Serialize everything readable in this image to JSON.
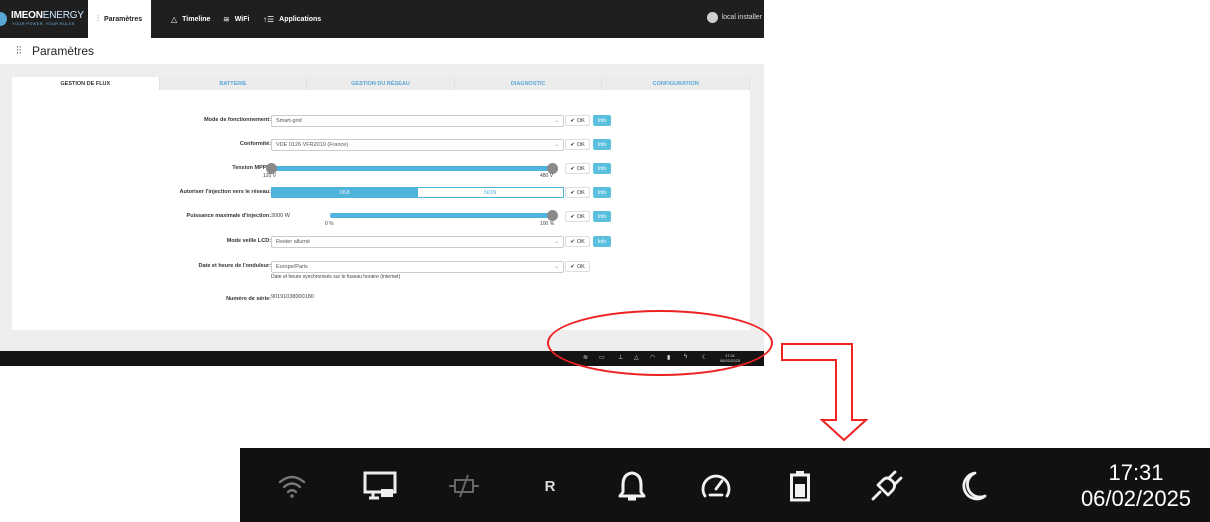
{
  "app": {
    "logo_name": "IMEON",
    "logo_name2": "ENERGY",
    "logo_tagline": "YOUR POWER, YOUR RULES",
    "brand_color": "#5aa7d6",
    "accent_color": "#4fb3dc"
  },
  "nav": {
    "items": [
      {
        "label": "Paramètres",
        "icon": "sliders-icon"
      },
      {
        "label": "Timeline",
        "icon": "bell-icon"
      },
      {
        "label": "WiFi",
        "icon": "wifi-icon"
      },
      {
        "label": "Applications",
        "icon": "apps-icon"
      }
    ],
    "user": "local installer"
  },
  "page": {
    "title": "Paramètres"
  },
  "tabs": [
    "GESTION DE FLUX",
    "BATTERIE",
    "GESTION DU RÉSEAU",
    "DIAGNOSTIC",
    "CONFIGURATION"
  ],
  "form": {
    "mode": {
      "label": "Mode de fonctionnement:",
      "value": "Smart-grid"
    },
    "conformite": {
      "label": "Conformité:",
      "value": "VDE 0126 VFR2019 (France)"
    },
    "mppt": {
      "label": "Tension MPPT:",
      "min": "120 V",
      "max": "480 V"
    },
    "injection": {
      "label": "Autoriser l'injection vers le réseau:",
      "on": "OUI",
      "off": "NON"
    },
    "puissance": {
      "label": "Puissance maximale d'injection:",
      "value": "3000 W",
      "min": "0 %",
      "max": "100 %",
      "level": 1.0
    },
    "lcd": {
      "label": "Mode veille LCD:",
      "value": "Rester allumé"
    },
    "date": {
      "label": "Date et heure de l'onduleur:",
      "value": "Europe/Paris",
      "note": "Date et heure synchronisés sur le fuseau horaire (internet)"
    },
    "serie": {
      "label": "Numéro de série:",
      "value": "90191038000180"
    },
    "ok_label": "OK",
    "info_label": "Info"
  },
  "taskbar": {
    "icons": [
      "wifi-icon",
      "monitor-icon",
      "relay-icon",
      "r-icon",
      "bell-icon",
      "gauge-icon",
      "battery-icon",
      "plug-icon",
      "moon-icon"
    ],
    "r_glyph": "R",
    "time": "17:31",
    "date": "06/02/2025"
  }
}
